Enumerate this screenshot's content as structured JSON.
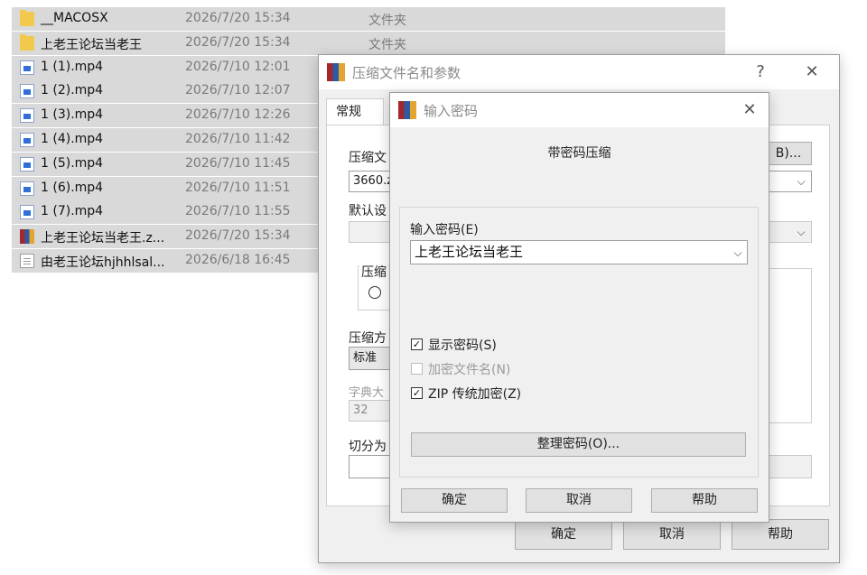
{
  "files": [
    {
      "name": "__MACOSX",
      "date": "2026/7/20 15:34",
      "type": "文件夹",
      "icon": "folder-icon",
      "selected": true
    },
    {
      "name": "上老王论坛当老王",
      "date": "2026/7/20 15:34",
      "type": "文件夹",
      "icon": "folder-icon",
      "selected": true
    },
    {
      "name": "1 (1).mp4",
      "date": "2026/7/10 12:01",
      "type": "",
      "icon": "video-file-icon",
      "selected": true
    },
    {
      "name": "1 (2).mp4",
      "date": "2026/7/10 12:07",
      "type": "",
      "icon": "video-file-icon",
      "selected": true
    },
    {
      "name": "1 (3).mp4",
      "date": "2026/7/10 12:26",
      "type": "",
      "icon": "video-file-icon",
      "selected": true
    },
    {
      "name": "1 (4).mp4",
      "date": "2026/7/10 11:42",
      "type": "",
      "icon": "video-file-icon",
      "selected": true
    },
    {
      "name": "1 (5).mp4",
      "date": "2026/7/10 11:45",
      "type": "",
      "icon": "video-file-icon",
      "selected": true
    },
    {
      "name": "1 (6).mp4",
      "date": "2026/7/10 11:51",
      "type": "",
      "icon": "video-file-icon",
      "selected": true
    },
    {
      "name": "1 (7).mp4",
      "date": "2026/7/10 11:55",
      "type": "",
      "icon": "video-file-icon",
      "selected": true
    },
    {
      "name": "上老王论坛当老王.z...",
      "date": "2026/7/20 15:34",
      "type": "",
      "icon": "winrar-archive-icon",
      "selected": true
    },
    {
      "name": "由老王论坛hjhhlsal...",
      "date": "2026/6/18 16:45",
      "type": "",
      "icon": "text-file-icon",
      "selected": true
    }
  ],
  "back_dialog": {
    "title": "压缩文件名和参数",
    "help_glyph": "?",
    "close_glyph": "✕",
    "tab_general": "常规",
    "archive_name_label": "压缩文",
    "archive_name_value": "3660.z",
    "browse_button": "B)...",
    "default_label": "默认设",
    "format_group_label": "压缩",
    "method_label": "压缩方",
    "method_value": "标准",
    "dict_label": "字典大",
    "dict_value": "32",
    "split_label": "切分为",
    "ok": "确定",
    "cancel": "取消",
    "help": "帮助"
  },
  "password_dialog": {
    "title": "输入密码",
    "close_glyph": "✕",
    "heading": "带密码压缩",
    "password_label": "输入密码(E)",
    "password_value": "上老王论坛当老王",
    "show_password": {
      "label": "显示密码(S)",
      "checked": true,
      "enabled": true
    },
    "encrypt_names": {
      "label": "加密文件名(N)",
      "checked": false,
      "enabled": false
    },
    "zip_legacy": {
      "label": "ZIP 传统加密(Z)",
      "checked": true,
      "enabled": true
    },
    "organize_button": "整理密码(O)...",
    "ok": "确定",
    "cancel": "取消",
    "help": "帮助"
  },
  "check_glyph": "✓",
  "chevron_glyph": "⌵",
  "colors": {
    "selection": "#d9d9d9",
    "dialog_bg": "#f0f0f0",
    "button": "#e1e1e1"
  }
}
